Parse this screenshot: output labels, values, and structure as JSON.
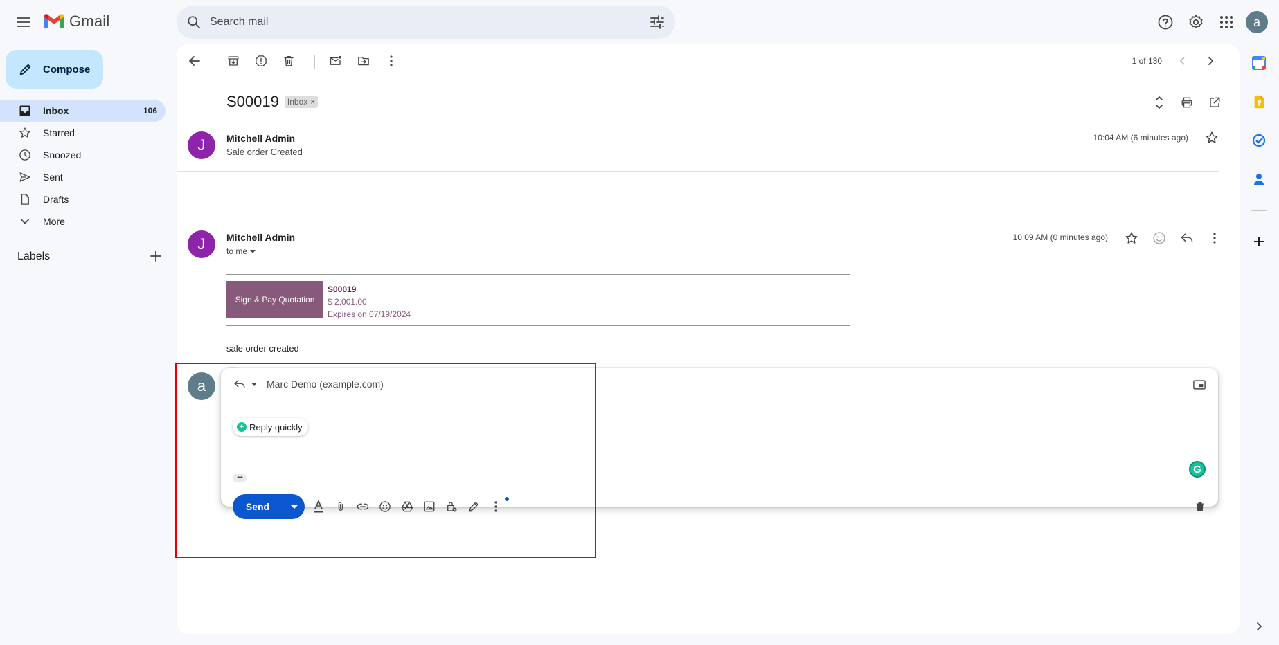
{
  "app": {
    "name": "Gmail"
  },
  "search": {
    "placeholder": "Search mail"
  },
  "compose": {
    "label": "Compose"
  },
  "nav": [
    {
      "label": "Inbox",
      "count": "106",
      "icon": "inbox-icon"
    },
    {
      "label": "Starred",
      "count": "",
      "icon": "star-icon"
    },
    {
      "label": "Snoozed",
      "count": "",
      "icon": "clock-icon"
    },
    {
      "label": "Sent",
      "count": "",
      "icon": "send-icon"
    },
    {
      "label": "Drafts",
      "count": "",
      "icon": "draft-icon"
    },
    {
      "label": "More",
      "count": "",
      "icon": "chevron-down-icon"
    }
  ],
  "labels": {
    "heading": "Labels"
  },
  "toolbar": {
    "pager": "1 of 130"
  },
  "thread": {
    "subject": "S00019",
    "label_chip": "Inbox",
    "chip_close": "×",
    "messages": [
      {
        "sender": "Mitchell Admin",
        "avatar": "J",
        "snippet": "Sale order Created",
        "time": "10:04 AM (6 minutes ago)"
      },
      {
        "sender": "Mitchell Admin",
        "avatar": "J",
        "to": "to me",
        "time": "10:09 AM (0 minutes ago)",
        "sign_button": "Sign & Pay Quotation",
        "order_ref": "S00019",
        "amount": "$ 2,001.00",
        "expires": "Expires on 07/19/2024",
        "body": "sale order created",
        "dots": "•••"
      }
    ]
  },
  "reply": {
    "avatar": "a",
    "to": "Marc Demo (example.com)",
    "quick_reply": "Reply quickly",
    "quick_icon": "+",
    "dots": "•••",
    "send": "Send",
    "grammarly": "G"
  },
  "user": {
    "avatar": "a"
  },
  "colors": {
    "accent": "#0b57d0",
    "compose_bg": "#c2e7ff",
    "active_nav": "#d3e3fd",
    "odoo_purple": "#875a7b",
    "avatar_purple": "#8e24aa",
    "highlight_box": "#e00000"
  }
}
